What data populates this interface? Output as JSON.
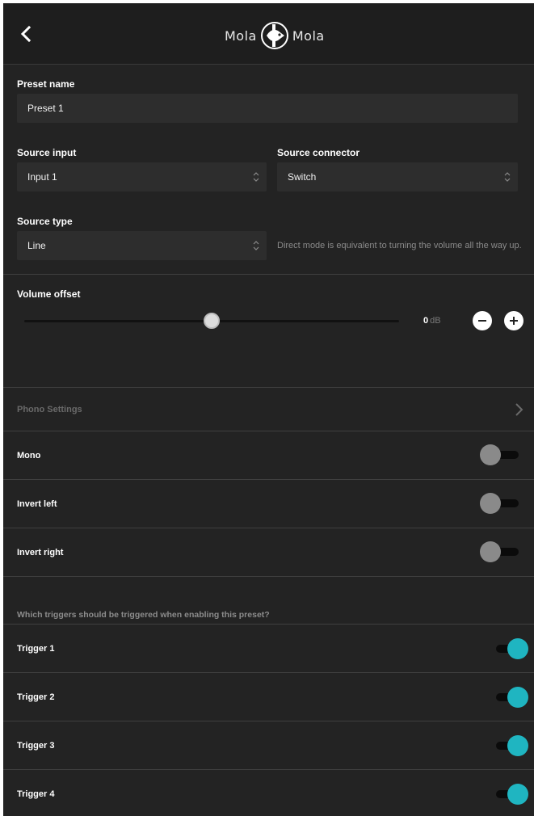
{
  "header": {
    "logo_left": "Mola",
    "logo_right": "Mola"
  },
  "preset": {
    "label": "Preset name",
    "value": "Preset 1"
  },
  "source_input": {
    "label": "Source input",
    "value": "Input 1"
  },
  "source_connector": {
    "label": "Source connector",
    "value": "Switch"
  },
  "source_type": {
    "label": "Source type",
    "value": "Line",
    "hint": "Direct mode is equivalent to turning the volume all the way up."
  },
  "volume": {
    "label": "Volume offset",
    "value": "0",
    "unit": "dB",
    "slider_fraction": 0.5
  },
  "phono": {
    "label": "Phono Settings"
  },
  "toggles": [
    {
      "label": "Mono",
      "on": false
    },
    {
      "label": "Invert left",
      "on": false
    },
    {
      "label": "Invert right",
      "on": false
    }
  ],
  "triggers_question": "Which triggers should be triggered when enabling this preset?",
  "triggers": [
    {
      "label": "Trigger 1",
      "on": true
    },
    {
      "label": "Trigger 2",
      "on": true
    },
    {
      "label": "Trigger 3",
      "on": true
    },
    {
      "label": "Trigger 4",
      "on": true
    }
  ],
  "colors": {
    "accent": "#1fb5c1",
    "background": "#232323",
    "field": "#2d2d2d"
  }
}
